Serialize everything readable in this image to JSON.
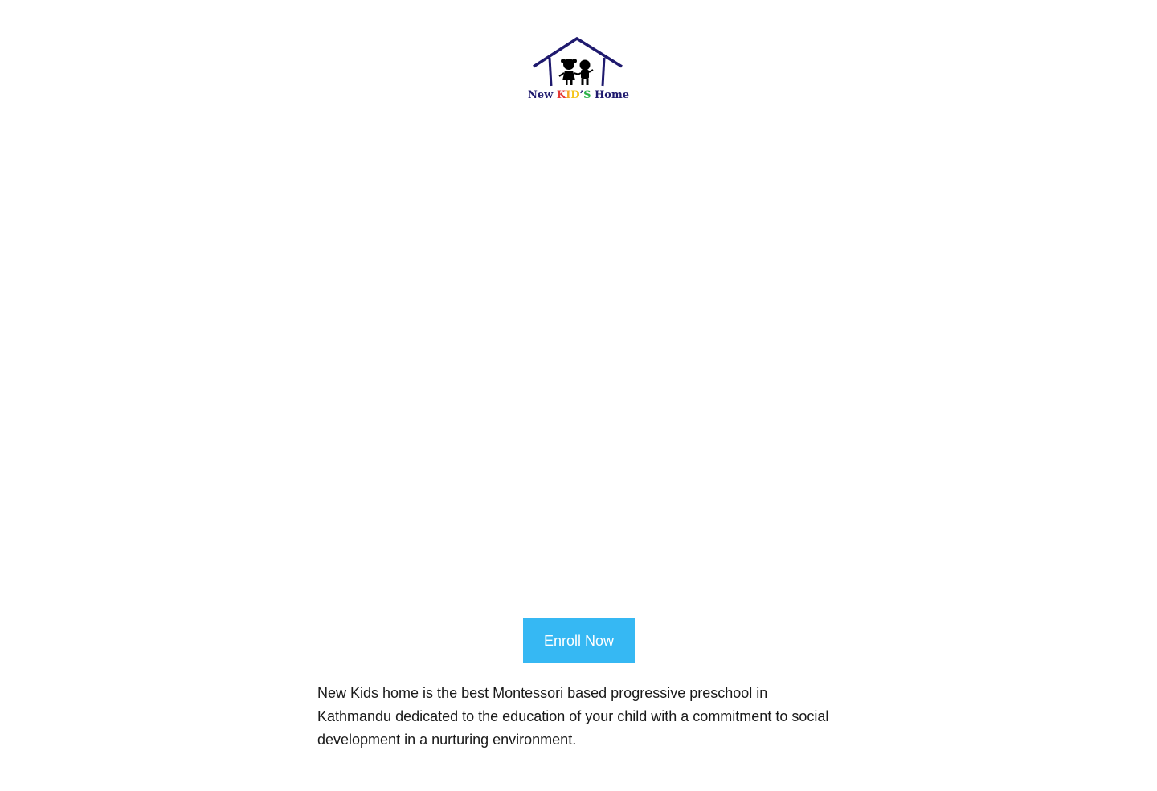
{
  "brand": {
    "logo_text_parts": [
      {
        "text": "New ",
        "color": "#1f1a6e"
      },
      {
        "text": "K",
        "color": "#e53935"
      },
      {
        "text": "I",
        "color": "#f5a623"
      },
      {
        "text": "D",
        "color": "#f5c518"
      },
      {
        "text": "’",
        "color": "#1f1a6e"
      },
      {
        "text": "S",
        "color": "#2bb34a"
      },
      {
        "text": " Home",
        "color": "#1f1a6e"
      }
    ],
    "roof_color": "#1f1a6e",
    "icon": "kids-house-logo-icon"
  },
  "hero": {
    "enroll_label": "Enroll Now",
    "button_color": "#36b8f3"
  },
  "intro": {
    "text": "New Kids home is the best Montessori based progressive preschool in Kathmandu dedicated to the education of your child with a commitment to social development in a nurturing environment."
  }
}
